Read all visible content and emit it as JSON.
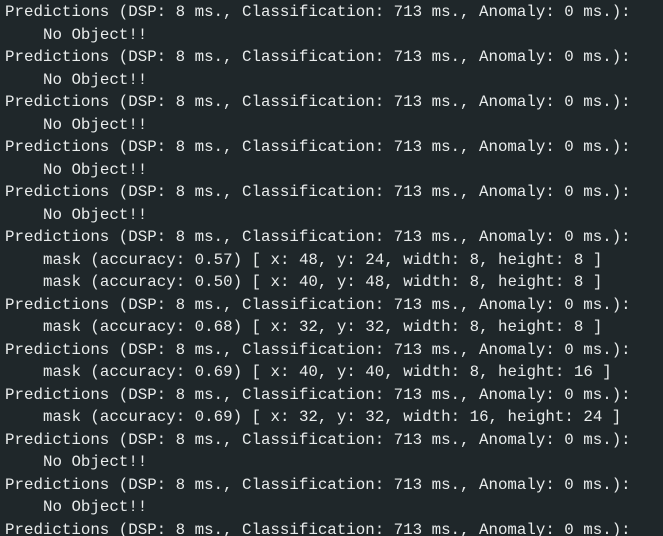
{
  "terminal": {
    "lines": [
      {
        "text": "Predictions (DSP: 8 ms., Classification: 713 ms., Anomaly: 0 ms.):",
        "indent": false
      },
      {
        "text": "No Object!!",
        "indent": true
      },
      {
        "text": "Predictions (DSP: 8 ms., Classification: 713 ms., Anomaly: 0 ms.):",
        "indent": false
      },
      {
        "text": "No Object!!",
        "indent": true
      },
      {
        "text": "Predictions (DSP: 8 ms., Classification: 713 ms., Anomaly: 0 ms.):",
        "indent": false
      },
      {
        "text": "No Object!!",
        "indent": true
      },
      {
        "text": "Predictions (DSP: 8 ms., Classification: 713 ms., Anomaly: 0 ms.):",
        "indent": false
      },
      {
        "text": "No Object!!",
        "indent": true
      },
      {
        "text": "Predictions (DSP: 8 ms., Classification: 713 ms., Anomaly: 0 ms.):",
        "indent": false
      },
      {
        "text": "No Object!!",
        "indent": true
      },
      {
        "text": "Predictions (DSP: 8 ms., Classification: 713 ms., Anomaly: 0 ms.):",
        "indent": false
      },
      {
        "text": "mask (accuracy: 0.57) [ x: 48, y: 24, width: 8, height: 8 ]",
        "indent": true
      },
      {
        "text": "mask (accuracy: 0.50) [ x: 40, y: 48, width: 8, height: 8 ]",
        "indent": true
      },
      {
        "text": "Predictions (DSP: 8 ms., Classification: 713 ms., Anomaly: 0 ms.):",
        "indent": false
      },
      {
        "text": "mask (accuracy: 0.68) [ x: 32, y: 32, width: 8, height: 8 ]",
        "indent": true
      },
      {
        "text": "Predictions (DSP: 8 ms., Classification: 713 ms., Anomaly: 0 ms.):",
        "indent": false
      },
      {
        "text": "mask (accuracy: 0.69) [ x: 40, y: 40, width: 8, height: 16 ]",
        "indent": true
      },
      {
        "text": "Predictions (DSP: 8 ms., Classification: 713 ms., Anomaly: 0 ms.):",
        "indent": false
      },
      {
        "text": "mask (accuracy: 0.69) [ x: 32, y: 32, width: 16, height: 24 ]",
        "indent": true
      },
      {
        "text": "Predictions (DSP: 8 ms., Classification: 713 ms., Anomaly: 0 ms.):",
        "indent": false
      },
      {
        "text": "No Object!!",
        "indent": true
      },
      {
        "text": "Predictions (DSP: 8 ms., Classification: 713 ms., Anomaly: 0 ms.):",
        "indent": false
      },
      {
        "text": "No Object!!",
        "indent": true
      },
      {
        "text": "Predictions (DSP: 8 ms., Classification: 713 ms., Anomaly: 0 ms.):",
        "indent": false
      }
    ]
  },
  "colors": {
    "background": "#1f272a",
    "text": "#e9ecec"
  }
}
